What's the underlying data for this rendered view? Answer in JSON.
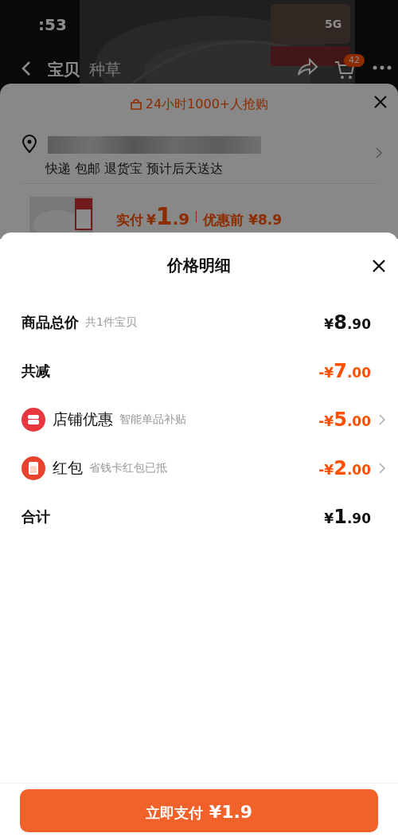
{
  "status_bar": {
    "time": ":53",
    "network": "5G"
  },
  "nav": {
    "tabs": [
      {
        "label": "宝贝",
        "selected": true
      },
      {
        "label": "种草",
        "selected": false
      }
    ],
    "cart_badge": "42"
  },
  "order_sheet": {
    "banner": "24小时1000+人抢购",
    "delivery": "快递 包邮 退货宝 预计后天送达",
    "paid_label": "实付",
    "paid_prefix": "¥",
    "paid_integer": "1",
    "paid_decimal": ".9",
    "before_label": "优惠前",
    "before_price": "¥8.9"
  },
  "price_detail": {
    "title": "价格明细",
    "rows": [
      {
        "label": "商品总价",
        "note": "共1件宝贝",
        "kind": "total",
        "prefix": "¥",
        "integer": "8",
        "decimal": ".90",
        "chevron": false
      },
      {
        "label": "共减",
        "kind": "discount",
        "prefix": "-¥",
        "integer": "7",
        "decimal": ".00",
        "chevron": false
      },
      {
        "label": "店铺优惠",
        "note": "智能单品补贴",
        "kind": "discount",
        "prefix": "-¥",
        "integer": "5",
        "decimal": ".00",
        "chevron": true
      },
      {
        "label": "红包",
        "note": "省钱卡红包已抵",
        "kind": "discount",
        "prefix": "-¥",
        "integer": "2",
        "decimal": ".00",
        "chevron": true
      },
      {
        "label": "合计",
        "kind": "total",
        "prefix": "¥",
        "integer": "1",
        "decimal": ".90",
        "chevron": false
      }
    ]
  },
  "pay_button": {
    "label": "立即支付",
    "price": "¥1.9"
  }
}
